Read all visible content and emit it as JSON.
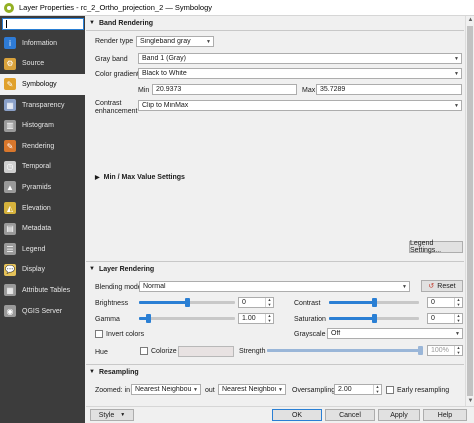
{
  "window": {
    "title": "Layer Properties - rc_2_Ortho_projection_2 — Symbology"
  },
  "search": {
    "value": "",
    "placeholder": ""
  },
  "sidebar": {
    "items": [
      {
        "label": "Information",
        "icon": "info-icon",
        "color": "#2e7bd6",
        "glyph": "i"
      },
      {
        "label": "Source",
        "icon": "source-icon",
        "color": "#d9a23c",
        "glyph": "⚙"
      },
      {
        "label": "Symbology",
        "icon": "symbology-icon",
        "color": "#e0a12c",
        "glyph": "✎"
      },
      {
        "label": "Transparency",
        "icon": "transparency-icon",
        "color": "#8aa0c8",
        "glyph": "▦"
      },
      {
        "label": "Histogram",
        "icon": "histogram-icon",
        "color": "#9a9a9a",
        "glyph": "▥"
      },
      {
        "label": "Rendering",
        "icon": "rendering-icon",
        "color": "#d9772c",
        "glyph": "✎"
      },
      {
        "label": "Temporal",
        "icon": "temporal-icon",
        "color": "#cfcfcf",
        "glyph": "◷"
      },
      {
        "label": "Pyramids",
        "icon": "pyramids-icon",
        "color": "#9a9a9a",
        "glyph": "▲"
      },
      {
        "label": "Elevation",
        "icon": "elevation-icon",
        "color": "#d6b23c",
        "glyph": "◭"
      },
      {
        "label": "Metadata",
        "icon": "metadata-icon",
        "color": "#9a9a9a",
        "glyph": "▤"
      },
      {
        "label": "Legend",
        "icon": "legend-icon",
        "color": "#9a9a9a",
        "glyph": "☰"
      },
      {
        "label": "Display",
        "icon": "display-icon",
        "color": "#e6c35a",
        "glyph": "💬"
      },
      {
        "label": "Attribute Tables",
        "icon": "attribute-tables-icon",
        "color": "#9a9a9a",
        "glyph": "▦"
      },
      {
        "label": "QGIS Server",
        "icon": "qgis-server-icon",
        "color": "#9a9a9a",
        "glyph": "◉"
      }
    ],
    "active_index": 2
  },
  "band_rendering": {
    "header": "Band Rendering",
    "render_type_label": "Render type",
    "render_type_value": "Singleband gray",
    "gray_band_label": "Gray band",
    "gray_band_value": "Band 1 (Gray)",
    "color_gradient_label": "Color gradient",
    "color_gradient_value": "Black to White",
    "min_label": "Min",
    "min_value": "20.9373",
    "max_label": "Max",
    "max_value": "35.7289",
    "contrast_label_1": "Contrast",
    "contrast_label_2": "enhancement",
    "contrast_value": "Clip to MinMax",
    "minmax_header": "Min / Max Value Settings",
    "legend_settings_button": "Legend Settings..."
  },
  "layer_rendering": {
    "header": "Layer Rendering",
    "blending_mode_label": "Blending mode",
    "blending_mode_value": "Normal",
    "reset_button": "Reset",
    "brightness_label": "Brightness",
    "brightness_value": "0",
    "brightness_level": 0.5,
    "contrast_label": "Contrast",
    "contrast_value": "0",
    "contrast_level": 0.5,
    "gamma_label": "Gamma",
    "gamma_value": "1.00",
    "gamma_level": 0.1,
    "saturation_label": "Saturation",
    "saturation_value": "0",
    "saturation_level": 0.5,
    "invert_colors_label": "Invert colors",
    "grayscale_label": "Grayscale",
    "grayscale_value": "Off",
    "hue_label": "Hue",
    "colorize_label": "Colorize",
    "strength_label": "Strength",
    "strength_value": "100%",
    "strength_level": 1.0
  },
  "resampling": {
    "header": "Resampling",
    "zoomed_in_label": "Zoomed: in",
    "zoomed_in_value": "Nearest Neighbour",
    "out_label": "out",
    "zoomed_out_value": "Nearest Neighbour",
    "oversampling_label": "Oversampling",
    "oversampling_value": "2.00",
    "early_resampling_label": "Early resampling"
  },
  "footer": {
    "style_button": "Style",
    "ok_button": "OK",
    "cancel_button": "Cancel",
    "apply_button": "Apply",
    "help_button": "Help"
  },
  "colors": {
    "accent": "#2a7fd4",
    "sidebar_bg": "#3c3c3c",
    "panel_bg": "#f0f0f0"
  }
}
